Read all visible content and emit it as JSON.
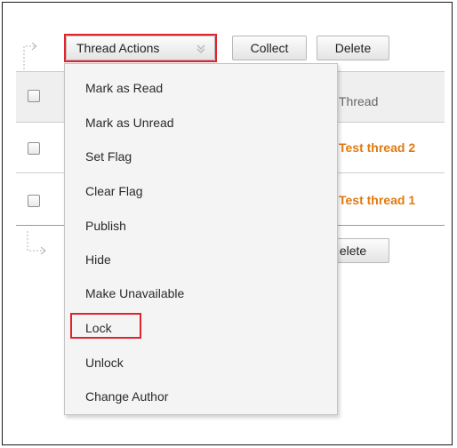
{
  "toolbar": {
    "thread_actions_label": "Thread Actions",
    "collect_label": "Collect",
    "delete_label": "Delete"
  },
  "table": {
    "column_header": "Thread",
    "rows": [
      {
        "title": "Test thread 2"
      },
      {
        "title": "Test thread 1"
      }
    ]
  },
  "bottom_toolbar": {
    "delete_label_partial": "elete"
  },
  "menu": {
    "items": [
      {
        "label": "Mark as Read"
      },
      {
        "label": "Mark as Unread"
      },
      {
        "label": "Set Flag"
      },
      {
        "label": "Clear Flag"
      },
      {
        "label": "Publish"
      },
      {
        "label": "Hide"
      },
      {
        "label": "Make Unavailable"
      },
      {
        "label": "Lock"
      },
      {
        "label": "Unlock"
      },
      {
        "label": "Change Author"
      }
    ]
  },
  "colors": {
    "highlight": "#e0242e",
    "link": "#e07a10"
  },
  "icons": {
    "top_arrow": "bend-right-arrow-icon",
    "bottom_arrow": "bend-down-right-arrow-icon",
    "chevron": "double-chevron-down-icon"
  }
}
